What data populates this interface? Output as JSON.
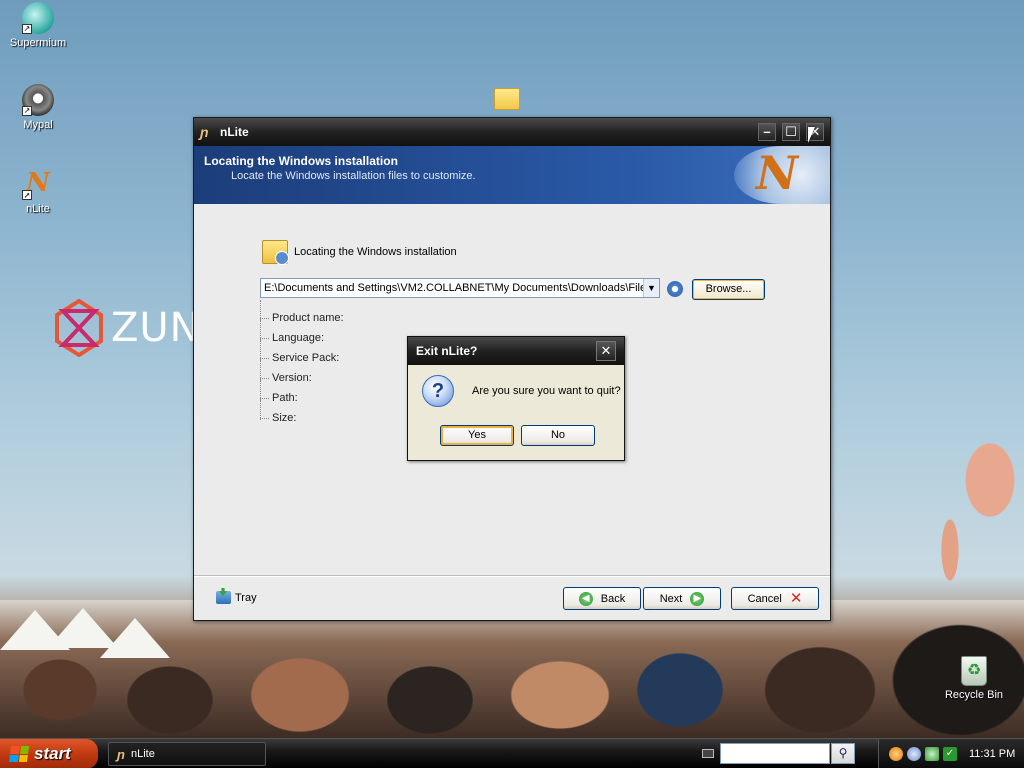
{
  "desktop": {
    "icons": [
      {
        "label": "Supermium"
      },
      {
        "label": "Mypal"
      },
      {
        "label": "nLite"
      },
      {
        "label": "Recycle Bin"
      }
    ],
    "brand_text": "ZUN"
  },
  "window": {
    "title": "nLite",
    "header": {
      "title": "Locating the Windows installation",
      "subtitle": "Locate the Windows installation files to customize."
    },
    "section_title": "Locating the Windows installation",
    "path_value": "E:\\Documents and Settings\\VM2.COLLABNET\\My Documents\\Downloads\\File",
    "browse_label": "Browse...",
    "properties": [
      "Product name:",
      "Language:",
      "Service Pack:",
      "Version:",
      "Path:",
      "Size:"
    ],
    "footer": {
      "tray_label": "Tray",
      "back_label": "Back",
      "next_label": "Next",
      "cancel_label": "Cancel"
    }
  },
  "dialog": {
    "title": "Exit nLite?",
    "message": "Are you sure you want to quit?",
    "yes_label": "Yes",
    "no_label": "No"
  },
  "taskbar": {
    "start_label": "start",
    "task_label": "nLite",
    "clock": "11:31 PM"
  },
  "colors": {
    "header_blue": "#2a5aa8",
    "start_orange": "#c03a10",
    "default_button_highlight": "#f0b040"
  }
}
